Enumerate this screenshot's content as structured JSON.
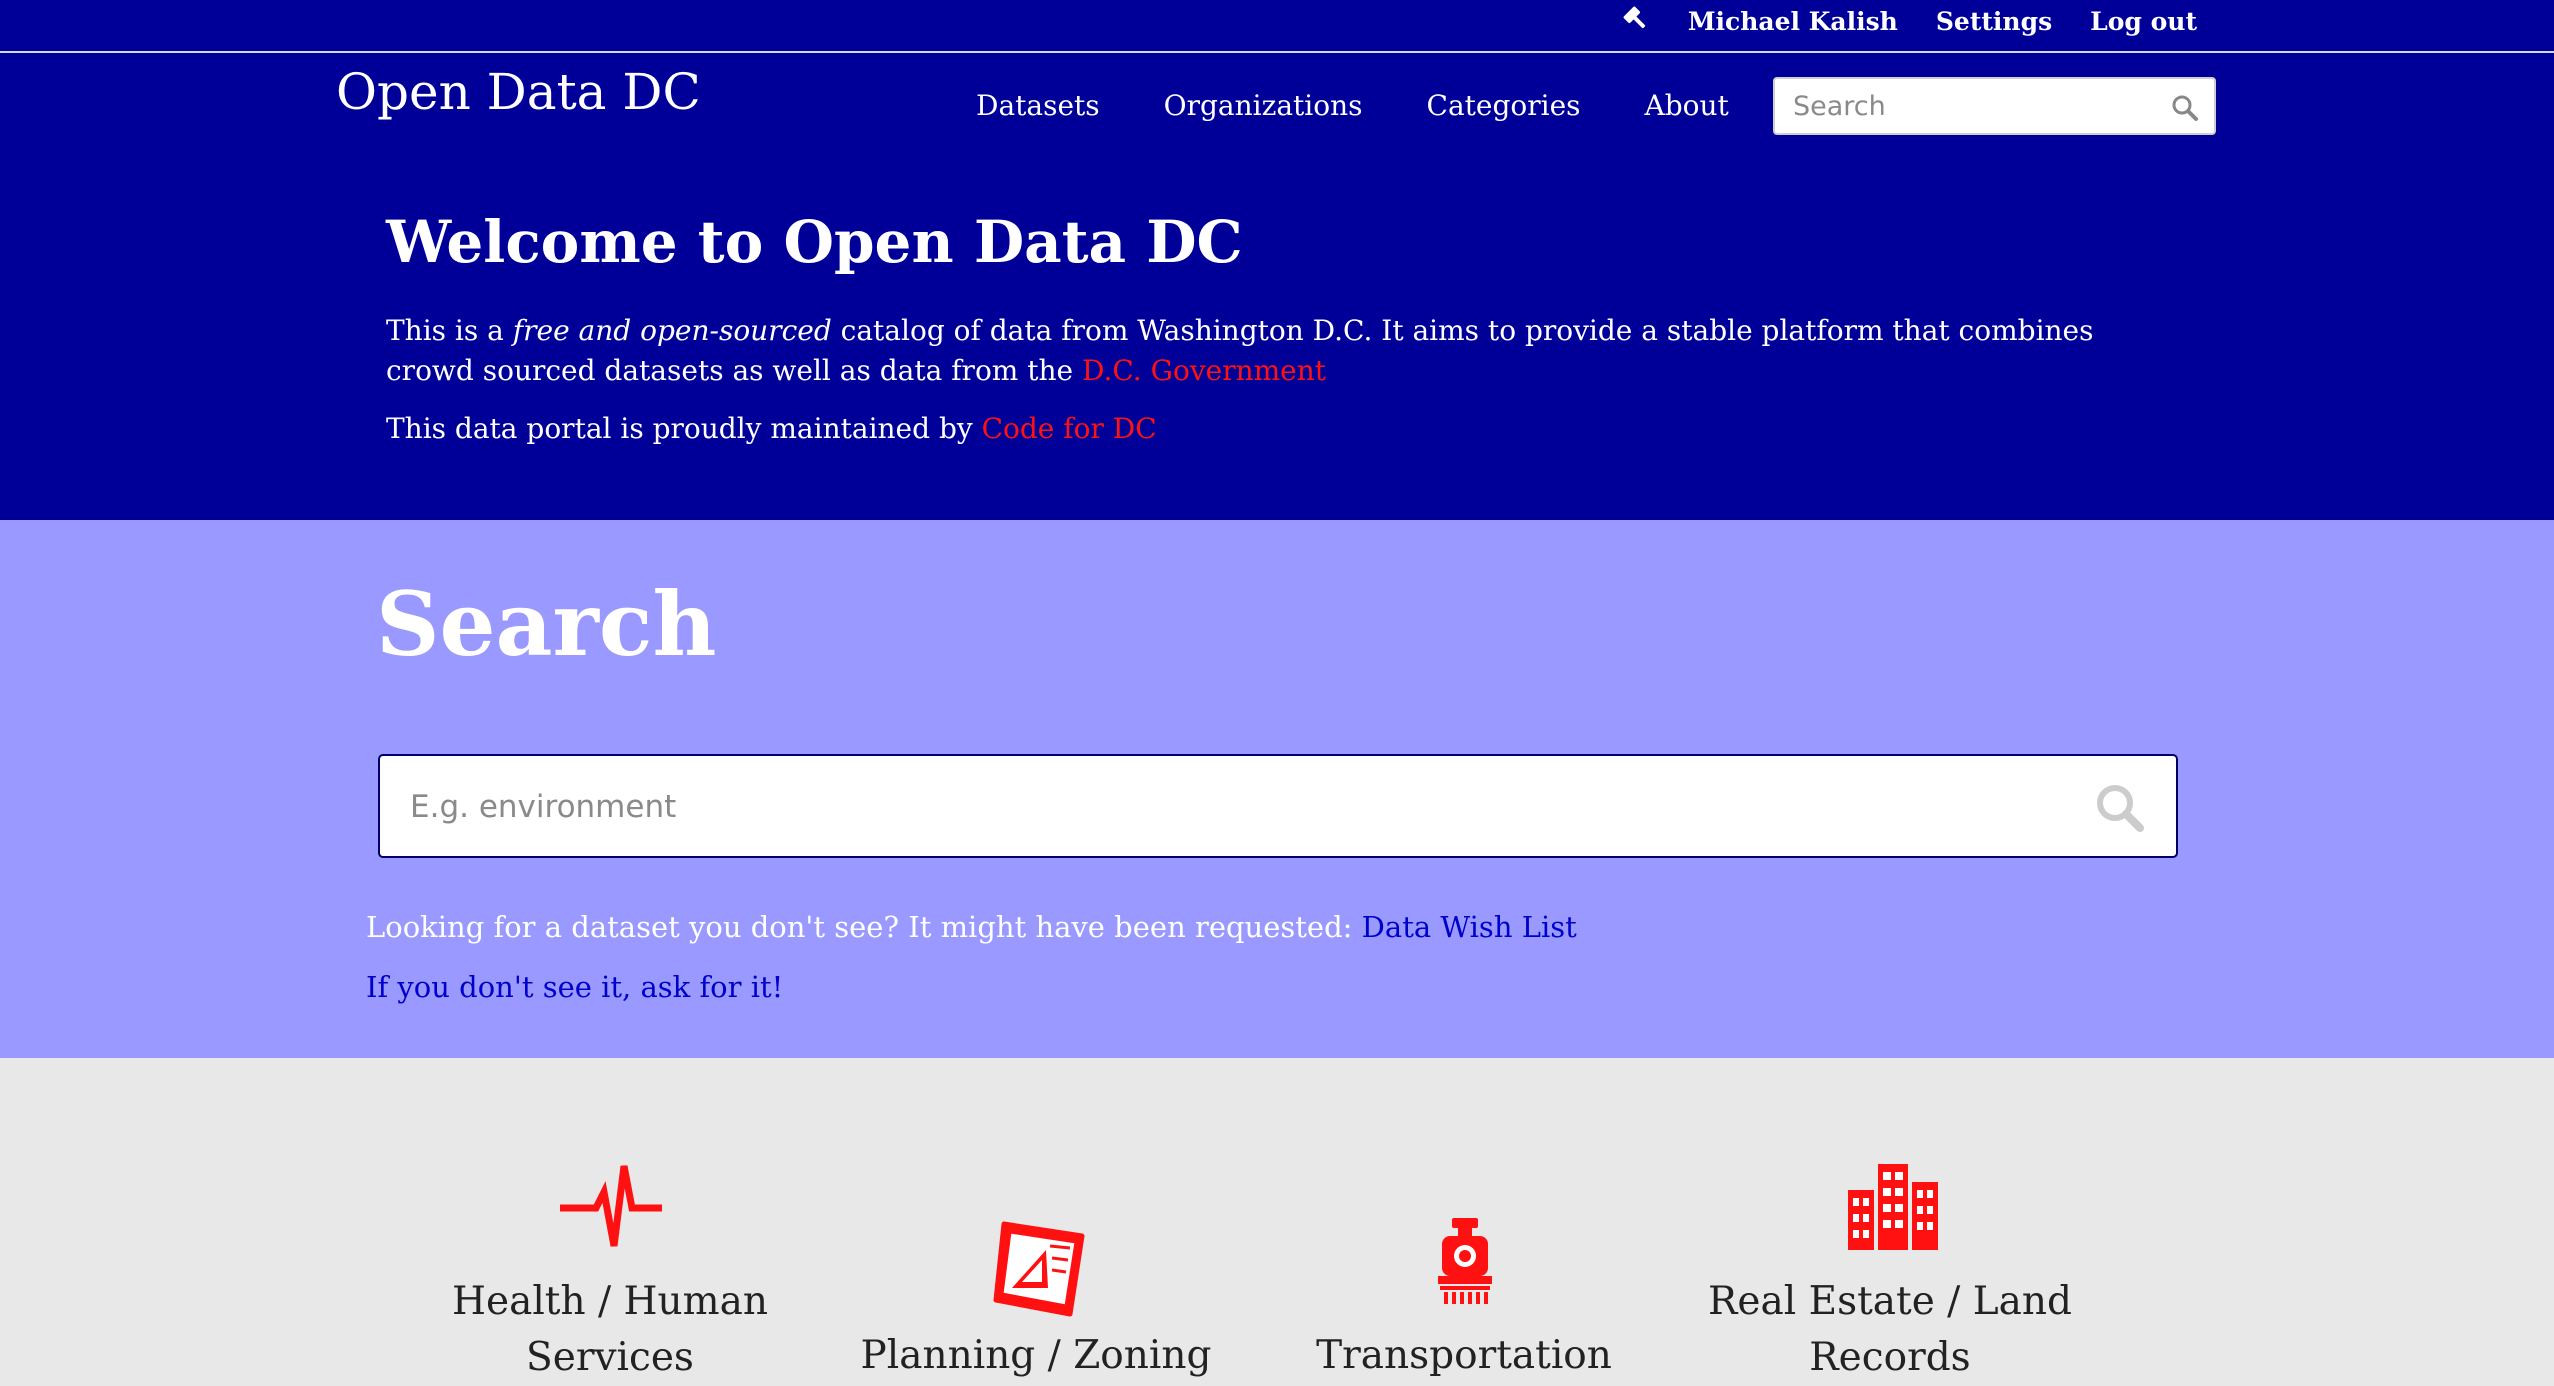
{
  "topbar": {
    "user_name": "Michael Kalish",
    "settings": "Settings",
    "logout": "Log out"
  },
  "header": {
    "site_title": "Open Data DC",
    "nav": [
      "Datasets",
      "Organizations",
      "Categories",
      "About"
    ],
    "search_placeholder": "Search"
  },
  "welcome": {
    "heading": "Welcome to Open Data DC",
    "intro_before": "This is a ",
    "intro_em": "free and open-sourced",
    "intro_after": " catalog of data from Washington D.C. It aims to provide a stable platform that combines crowd sourced datasets as well as data from the ",
    "dc_gov_link": "D.C. Government",
    "maintained_before": "This data portal is proudly maintained by ",
    "code_for_dc_link": "Code for DC"
  },
  "search_section": {
    "heading": "Search",
    "placeholder": "E.g. environment",
    "wish_text": "Looking for a dataset you don't see? It might have been requested: ",
    "wish_link": "Data Wish List",
    "ask_link": "If you don't see it, ask for it!"
  },
  "categories": [
    {
      "label": "Health / Human Services",
      "icon": "pulse-icon"
    },
    {
      "label": "Planning / Zoning",
      "icon": "blueprint-icon"
    },
    {
      "label": "Transportation",
      "icon": "train-icon"
    },
    {
      "label": "Real Estate / Land Records",
      "icon": "buildings-icon"
    }
  ],
  "colors": {
    "header_bg": "#000099",
    "search_band_bg": "#9999ff",
    "accent_red": "#ff1111",
    "link_blue": "#0000cc",
    "categories_bg": "#e8e8e8"
  }
}
